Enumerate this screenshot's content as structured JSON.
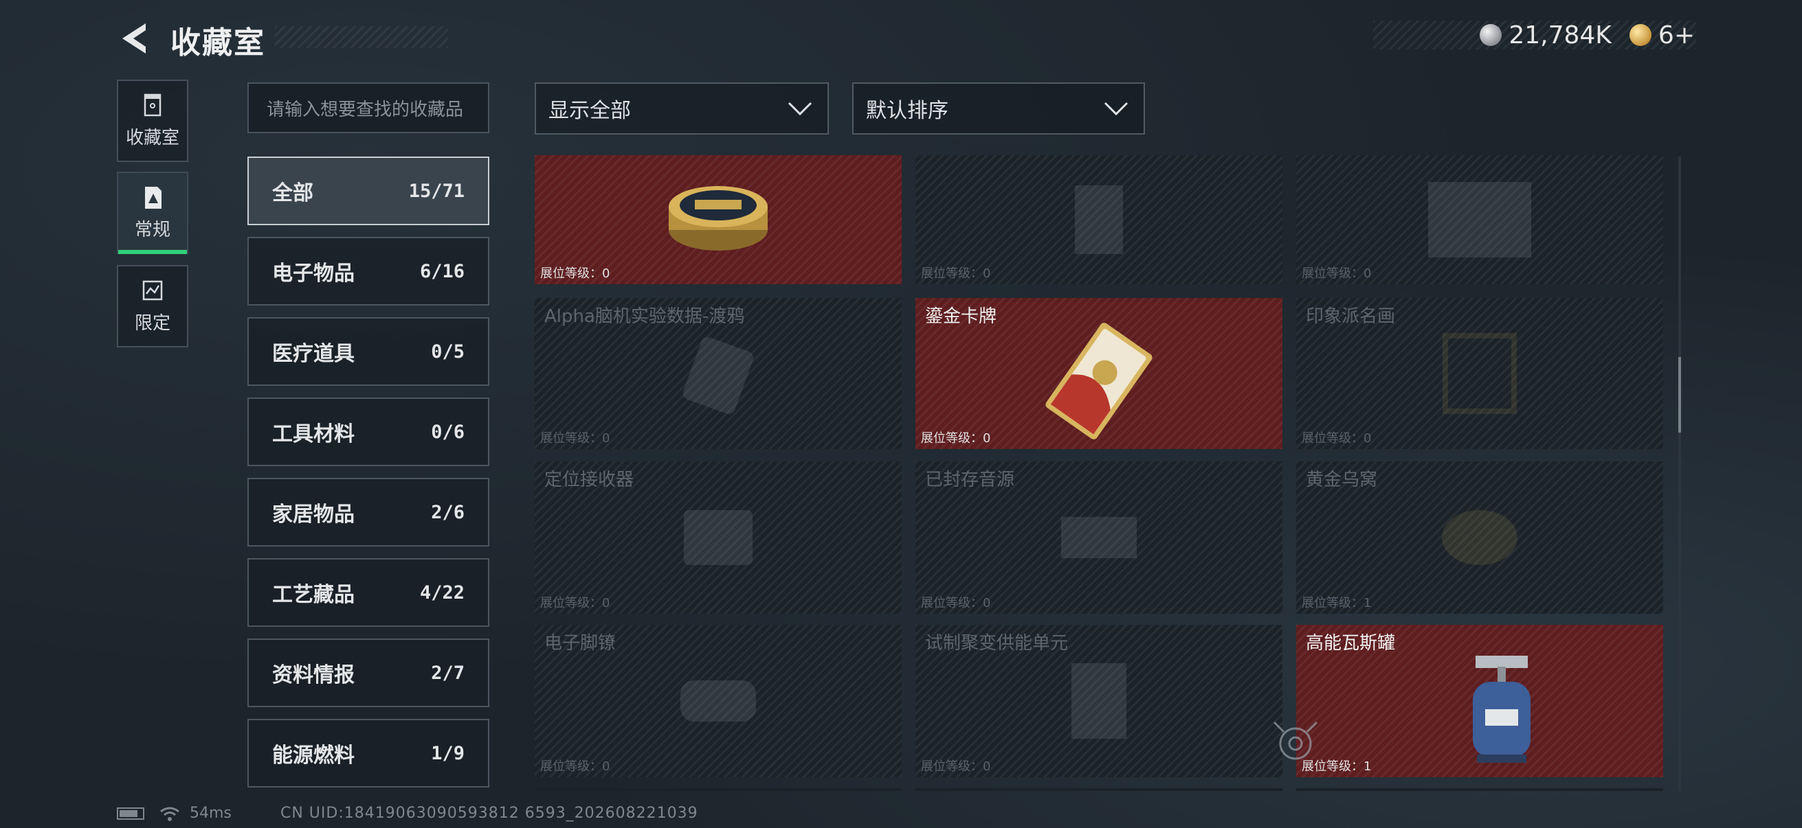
{
  "header": {
    "title": "收藏室",
    "currency_amount": "21,784K",
    "token_amount": "6+",
    "currency_icon": "silver-coin-icon",
    "token_icon": "gold-token-icon"
  },
  "side_tabs": [
    {
      "label": "收藏室",
      "icon": "cabinet-icon",
      "active": false
    },
    {
      "label": "常规",
      "icon": "card-icon",
      "active": true
    },
    {
      "label": "限定",
      "icon": "limited-icon",
      "active": false
    }
  ],
  "search": {
    "placeholder": "请输入想要查找的收藏品"
  },
  "categories": [
    {
      "label": "全部",
      "count": "15/71",
      "active": true
    },
    {
      "label": "电子物品",
      "count": "6/16",
      "active": false
    },
    {
      "label": "医疗道具",
      "count": "0/5",
      "active": false
    },
    {
      "label": "工具材料",
      "count": "0/6",
      "active": false
    },
    {
      "label": "家居物品",
      "count": "2/6",
      "active": false
    },
    {
      "label": "工艺藏品",
      "count": "4/22",
      "active": false
    },
    {
      "label": "资料情报",
      "count": "2/7",
      "active": false
    },
    {
      "label": "能源燃料",
      "count": "1/9",
      "active": false
    }
  ],
  "filters": {
    "display_label": "显示全部",
    "sort_label": "默认排序"
  },
  "items": [
    {
      "name": "",
      "level": "展位等级：0",
      "owned": true,
      "icon": "caviar-tin-icon"
    },
    {
      "name": "",
      "level": "展位等级：0",
      "owned": false,
      "icon": "device-icon"
    },
    {
      "name": "",
      "level": "展位等级：0",
      "owned": false,
      "icon": "box-icon"
    },
    {
      "name": "Alpha脑机实验数据-渡鸦",
      "level": "展位等级：0",
      "owned": false,
      "icon": "data-drive-icon"
    },
    {
      "name": "鎏金卡牌",
      "level": "展位等级：0",
      "owned": true,
      "icon": "gilded-card-icon"
    },
    {
      "name": "印象派名画",
      "level": "展位等级：0",
      "owned": false,
      "icon": "painting-icon"
    },
    {
      "name": "定位接收器",
      "level": "展位等级：0",
      "owned": false,
      "icon": "receiver-icon"
    },
    {
      "name": "已封存音源",
      "level": "展位等级：0",
      "owned": false,
      "icon": "sealed-audio-icon"
    },
    {
      "name": "黄金乌窝",
      "level": "展位等级：1",
      "owned": false,
      "icon": "golden-nest-icon"
    },
    {
      "name": "电子脚镣",
      "level": "展位等级：0",
      "owned": false,
      "icon": "ankle-monitor-icon"
    },
    {
      "name": "试制聚变供能单元",
      "level": "展位等级：0",
      "owned": false,
      "icon": "fusion-cell-icon"
    },
    {
      "name": "高能瓦斯罐",
      "level": "展位等级：1",
      "owned": true,
      "icon": "gas-canister-icon"
    }
  ],
  "status": {
    "ping": "54ms",
    "uid": "CN UID:18419063090593812 6593_202608221039"
  },
  "colors": {
    "accent_green": "#2fd17a",
    "owned_card": "#5e1d1f",
    "locked_card": "#1b2329"
  }
}
